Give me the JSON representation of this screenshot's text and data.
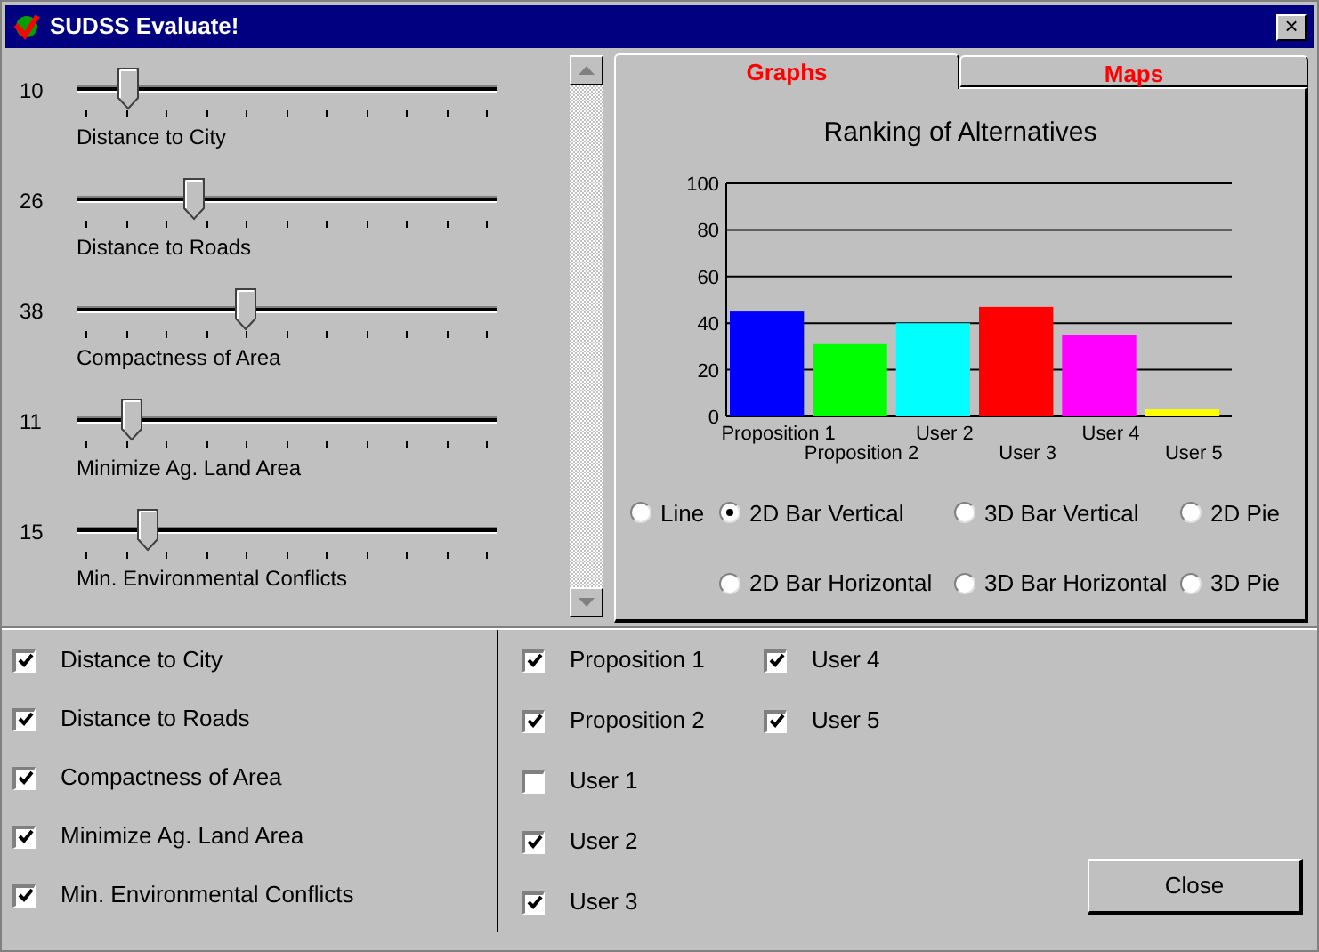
{
  "window": {
    "title": "SUDSS Evaluate!",
    "close": "×"
  },
  "sliders": [
    {
      "value": "10",
      "label": "Distance to City",
      "level": 0.1
    },
    {
      "value": "26",
      "label": "Distance to Roads",
      "level": 0.26
    },
    {
      "value": "38",
      "label": "Compactness of Area",
      "level": 0.38
    },
    {
      "value": "11",
      "label": "Minimize Ag. Land Area",
      "level": 0.11
    },
    {
      "value": "15",
      "label": "Min. Environmental Conflicts",
      "level": 0.15
    }
  ],
  "tabs": [
    {
      "label": "Graphs",
      "selected": true
    },
    {
      "label": "Maps",
      "selected": false
    }
  ],
  "chart": {
    "chart_data": {
      "type": "bar",
      "title": "Ranking of Alternatives",
      "categories": [
        "Proposition 1",
        "Proposition 2",
        "User 2",
        "User 3",
        "User 4",
        "User 5"
      ],
      "grid": true,
      "series": [
        {
          "colors": [
            "#0000ff",
            "#00ff00",
            "#00ffff",
            "#ff0000",
            "#ff00ff",
            "#ffff00"
          ],
          "values": [
            45,
            31,
            40,
            47,
            35,
            3
          ]
        }
      ],
      "ylim": [
        0,
        100
      ],
      "yticks": [
        0,
        20,
        40,
        60,
        80,
        100
      ]
    }
  },
  "chart_types": [
    [
      {
        "label": "Line",
        "selected": false
      },
      {
        "label": "2D Bar Vertical",
        "selected": true
      },
      {
        "label": "3D Bar Vertical",
        "selected": false
      },
      {
        "label": "2D Pie",
        "selected": false
      }
    ],
    [
      {
        "label": "2D Bar Horizontal",
        "selected": false
      },
      {
        "label": "3D Bar Horizontal",
        "selected": false
      },
      {
        "label": "3D Pie",
        "selected": false
      }
    ]
  ],
  "criteria": [
    {
      "label": "Distance to City",
      "checked": true
    },
    {
      "label": "Distance to Roads",
      "checked": true
    },
    {
      "label": "Compactness of Area",
      "checked": true
    },
    {
      "label": "Minimize Ag. Land Area",
      "checked": true
    },
    {
      "label": "Min. Environmental Conflicts",
      "checked": true
    }
  ],
  "alternatives": [
    [
      {
        "label": "Proposition 1",
        "checked": true
      },
      {
        "label": "Proposition 2",
        "checked": true
      },
      {
        "label": "User 1",
        "checked": false
      },
      {
        "label": "User 2",
        "checked": true
      },
      {
        "label": "User 3",
        "checked": true
      }
    ],
    [
      {
        "label": "User 4",
        "checked": true
      },
      {
        "label": "User 5",
        "checked": true
      }
    ]
  ],
  "buttons": [
    "Close"
  ]
}
